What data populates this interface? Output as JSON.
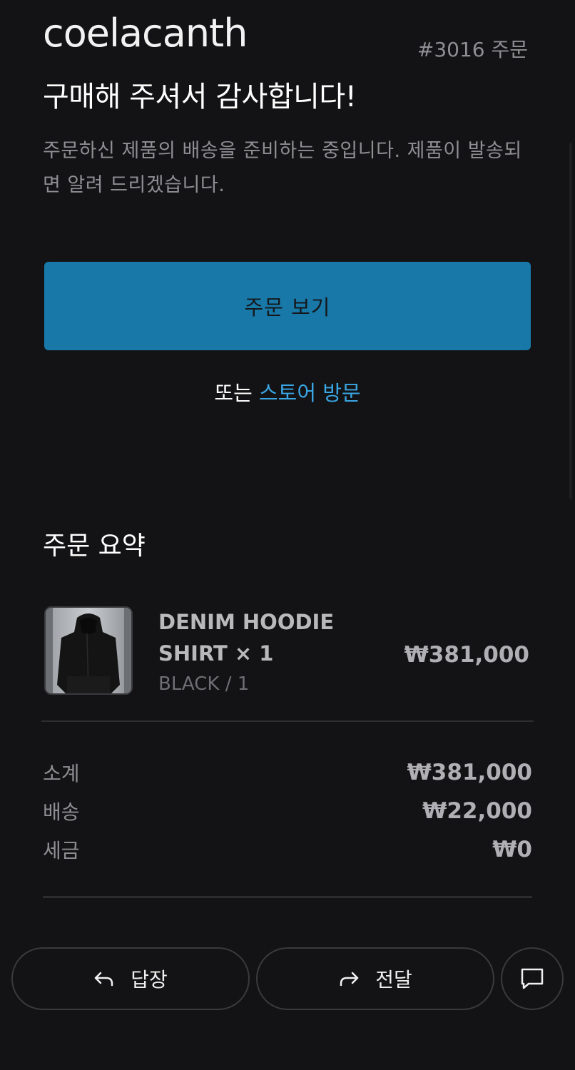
{
  "header": {
    "store_name": "coelacanth",
    "order_number": "#3016 주문"
  },
  "confirmation": {
    "title": "구매해 주셔서 감사합니다!",
    "message": "주문하신 제품의 배송을 준비하는 중입니다. 제품이 발송되면 알려 드리겠습니다.",
    "view_order_label": "주문 보기",
    "or_text": "또는",
    "visit_store_label": "스토어 방문"
  },
  "summary": {
    "heading": "주문 요약",
    "items": [
      {
        "name": "DENIM HOODIE SHIRT × 1",
        "variant": "BLACK / 1",
        "price": "₩381,000"
      }
    ],
    "totals": [
      {
        "label": "소계",
        "value": "₩381,000"
      },
      {
        "label": "배송",
        "value": "₩22,000"
      },
      {
        "label": "세금",
        "value": "₩0"
      }
    ]
  },
  "actions": {
    "reply_label": "답장",
    "forward_label": "전달",
    "reply_icon": "reply-arrow-icon",
    "forward_icon": "forward-arrow-icon",
    "chat_icon": "chat-bubble-icon"
  },
  "colors": {
    "background": "#131315",
    "accent_button": "#1879a9",
    "link": "#3aa6e4"
  }
}
